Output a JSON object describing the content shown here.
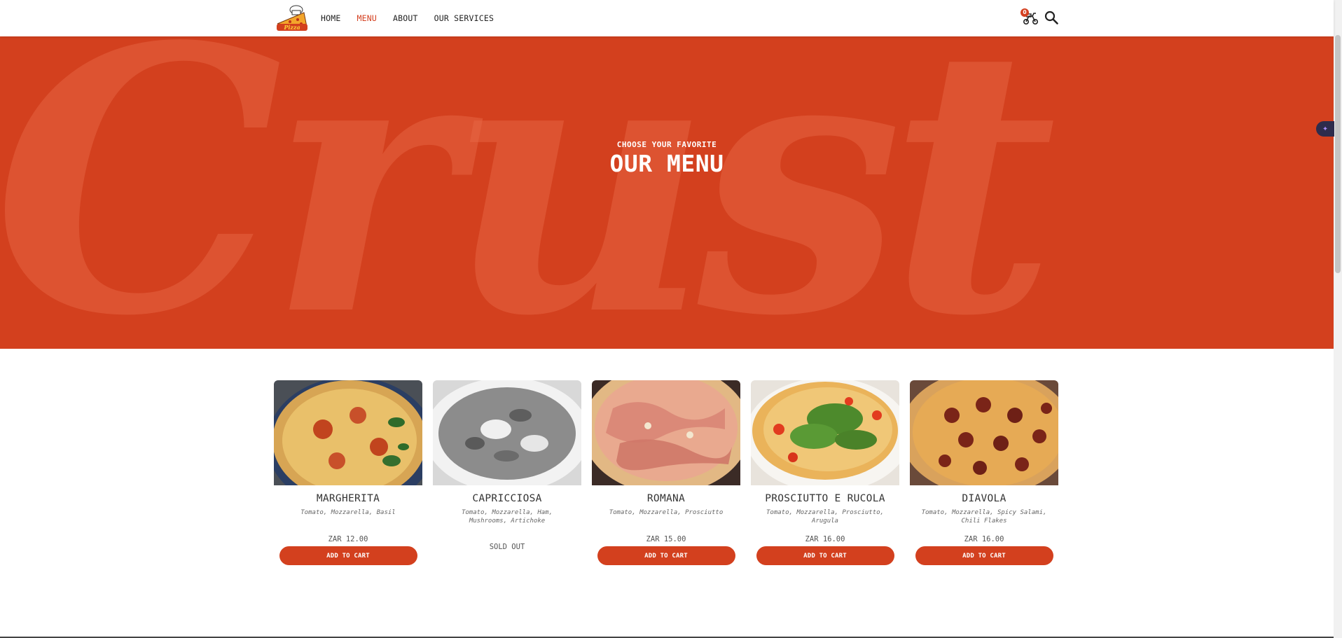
{
  "header": {
    "logo_text": "Pizza",
    "nav": [
      {
        "label": "HOME",
        "active": false
      },
      {
        "label": "MENU",
        "active": true
      },
      {
        "label": "ABOUT",
        "active": false
      },
      {
        "label": "OUR SERVICES",
        "active": false
      }
    ],
    "cart_count": "0",
    "icons": {
      "cart": "scooter-cart-icon",
      "search": "search-icon",
      "logo": "pizza-chef-logo"
    }
  },
  "hero": {
    "background_word": "Crust",
    "subtitle": "CHOOSE YOUR FAVORITE",
    "title": "OUR MENU",
    "accent_color": "#d3401e"
  },
  "menu": {
    "items": [
      {
        "name": "MARGHERITA",
        "ingredients": "Tomato, Mozzarella, Basil",
        "price": "ZAR 12.00",
        "button": "ADD TO CART",
        "sold_out": false,
        "image": "margherita-pizza-photo"
      },
      {
        "name": "CAPRICCIOSA",
        "ingredients": "Tomato, Mozzarella, Ham, Mushrooms, Artichoke",
        "price": "",
        "button": "",
        "status": "SOLD OUT",
        "sold_out": true,
        "image": "capricciosa-pizza-photo-grayscale"
      },
      {
        "name": "ROMANA",
        "ingredients": "Tomato, Mozzarella, Prosciutto",
        "price": "ZAR 15.00",
        "button": "ADD TO CART",
        "sold_out": false,
        "image": "romana-pizza-photo"
      },
      {
        "name": "PROSCIUTTO E RUCOLA",
        "ingredients": "Tomato, Mozzarella, Prosciutto, Arugula",
        "price": "ZAR 16.00",
        "button": "ADD TO CART",
        "sold_out": false,
        "image": "prosciutto-rucola-pizza-photo"
      },
      {
        "name": "DIAVOLA",
        "ingredients": "Tomato, Mozzarella, Spicy Salami, Chili Flakes",
        "price": "ZAR 16.00",
        "button": "ADD TO CART",
        "sold_out": false,
        "image": "diavola-pizza-photo"
      }
    ]
  },
  "ai_assistant": {
    "icon": "sparkle-icon"
  }
}
